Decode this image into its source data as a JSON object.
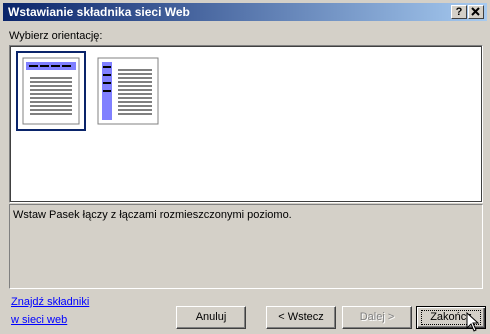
{
  "window": {
    "title": "Wstawianie składnika sieci Web",
    "help_label": "?",
    "close_label": "✕"
  },
  "prompt_label": "Wybierz orientację:",
  "description": "Wstaw Pasek łączy z łączami rozmieszczonymi poziomo.",
  "link": {
    "line1": "Znajdź składniki",
    "line2": "w sieci web"
  },
  "buttons": {
    "cancel": "Anuluj",
    "back": "< Wstecz",
    "next": "Dalej >",
    "finish": "Zakończ"
  },
  "colors": {
    "titlebar_start": "#0a246a",
    "titlebar_end": "#a6caf0",
    "accent": "#000080",
    "link": "#0000ff"
  }
}
